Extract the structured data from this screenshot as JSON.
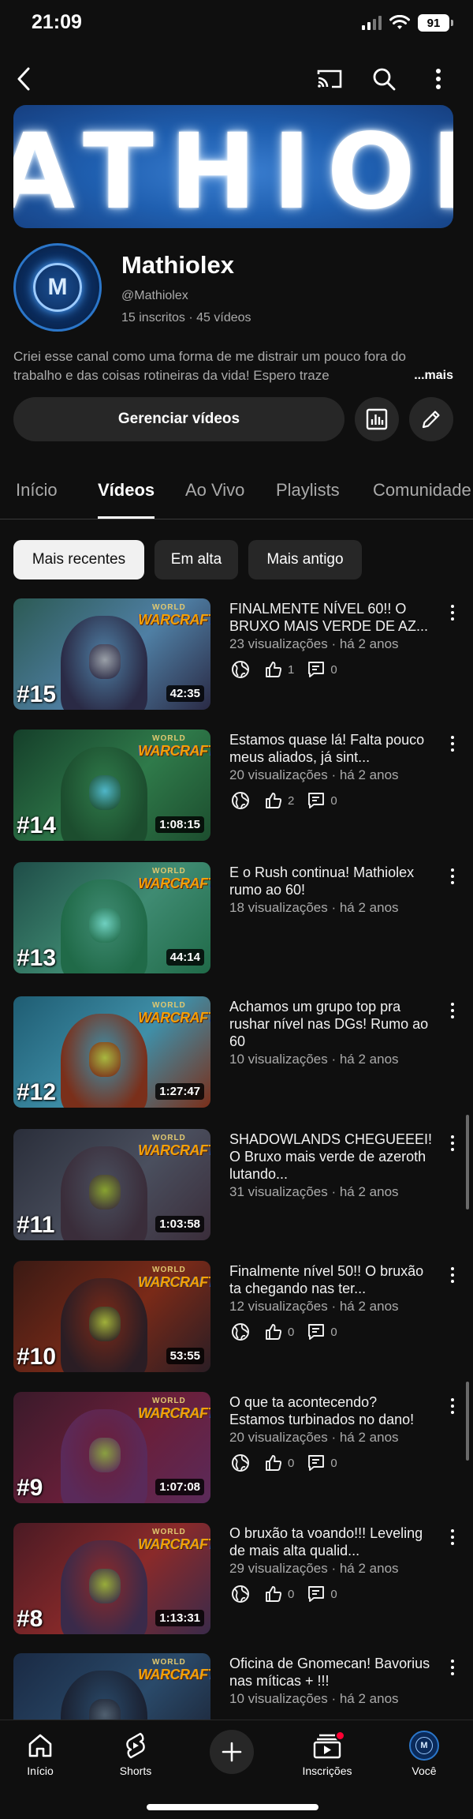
{
  "status_bar": {
    "time": "21:09",
    "battery": "91"
  },
  "banner": {
    "text": "ATHIOLE"
  },
  "channel": {
    "avatar_letter": "M",
    "name": "Mathiolex",
    "handle": "@Mathiolex",
    "stats": "15 inscritos · 45 vídeos",
    "description": "Criei esse canal como uma forma de me distrair um pouco fora do trabalho e das coisas rotineiras da vida! Espero traze",
    "more_label": "...mais",
    "manage_label": "Gerenciar vídeos"
  },
  "tabs": [
    "Início",
    "Vídeos",
    "Ao Vivo",
    "Playlists",
    "Comunidade"
  ],
  "chips": [
    "Mais recentes",
    "Em alta",
    "Mais antigo"
  ],
  "thumb_brand": {
    "top": "WORLD",
    "bottom": "WARCRAFT"
  },
  "videos": [
    {
      "num": "#15",
      "duration": "42:35",
      "title": "FINALMENTE NÍVEL 60!! O BRUXO MAIS VERDE DE AZ...",
      "meta": "23 visualizações · há 2 anos",
      "likes": "1",
      "comments": "0"
    },
    {
      "num": "#14",
      "duration": "1:08:15",
      "title": "Estamos quase lá! Falta pouco meus aliados, já sint...",
      "meta": "20 visualizações · há 2 anos",
      "likes": "2",
      "comments": "0"
    },
    {
      "num": "#13",
      "duration": "44:14",
      "title": "E o Rush continua! Mathiolex rumo ao 60!",
      "meta": "18 visualizações · há 2 anos"
    },
    {
      "num": "#12",
      "duration": "1:27:47",
      "title": "Achamos um grupo top pra rushar nível nas DGs! Rumo ao 60",
      "meta": "10 visualizações · há 2 anos"
    },
    {
      "num": "#11",
      "duration": "1:03:58",
      "title": "SHADOWLANDS CHEGUEEEI! O Bruxo mais verde de azeroth lutando...",
      "meta": "31 visualizações · há 2 anos"
    },
    {
      "num": "#10",
      "duration": "53:55",
      "title": "Finalmente nível 50!! O bruxão ta chegando nas ter...",
      "meta": "12 visualizações · há 2 anos",
      "likes": "0",
      "comments": "0"
    },
    {
      "num": "#9",
      "duration": "1:07:08",
      "title": "O que ta acontecendo? Estamos turbinados no dano!",
      "meta": "20 visualizações · há 2 anos",
      "likes": "0",
      "comments": "0"
    },
    {
      "num": "#8",
      "duration": "1:13:31",
      "title": "O bruxão ta voando!!! Leveling de mais alta qualid...",
      "meta": "29 visualizações · há 2 anos",
      "likes": "0",
      "comments": "0"
    },
    {
      "num": "",
      "duration": "",
      "title": "Oficina de Gnomecan! Bavorius nas míticas + !!!",
      "meta": "10 visualizações · há 2 anos"
    }
  ],
  "bottom_nav": [
    "Início",
    "Shorts",
    "Inscrições",
    "Você"
  ],
  "colors": {
    "background": "#0f0f0f",
    "chip_bg": "#272727",
    "notification_dot": "#ff0033"
  }
}
